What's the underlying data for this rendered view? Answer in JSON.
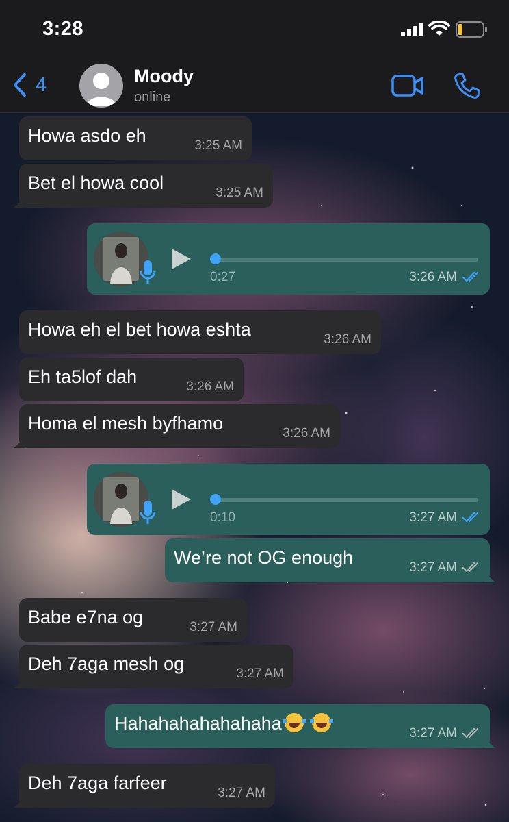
{
  "status_bar": {
    "time": "3:28"
  },
  "header": {
    "back_count": "4",
    "contact_name": "Moody",
    "contact_status": "online"
  },
  "colors": {
    "accent": "#3b8ff5",
    "incoming_bubble": "#2b2b2d",
    "outgoing_bubble": "#2a5f5c",
    "voice_progress": "#3fa4f8",
    "battery_low": "#f5c33b"
  },
  "messages": [
    {
      "dir": "in",
      "text": "Howa asdo eh",
      "time": "3:25 AM"
    },
    {
      "dir": "in",
      "text": "Bet el howa cool",
      "time": "3:25 AM"
    },
    {
      "dir": "out",
      "type": "voice",
      "duration": "0:27",
      "time": "3:26 AM",
      "progress": 0
    },
    {
      "dir": "in",
      "text": "Howa eh el bet howa eshta",
      "time": "3:26 AM"
    },
    {
      "dir": "in",
      "text": "Eh ta5lof dah",
      "time": "3:26 AM"
    },
    {
      "dir": "in",
      "text": "Homa el mesh byfhamo",
      "time": "3:26 AM"
    },
    {
      "dir": "out",
      "type": "voice",
      "duration": "0:10",
      "time": "3:27 AM",
      "progress": 0
    },
    {
      "dir": "out",
      "text": "We’re not OG enough",
      "time": "3:27 AM"
    },
    {
      "dir": "in",
      "text": "Babe e7na og",
      "time": "3:27 AM"
    },
    {
      "dir": "in",
      "text": "Deh 7aga mesh og",
      "time": "3:27 AM"
    },
    {
      "dir": "out",
      "text": "Hahahahahahahaha",
      "emoji": "tears-of-joy-emoji",
      "time": "3:27 AM"
    },
    {
      "dir": "in",
      "text": "Deh 7aga farfeer",
      "time": "3:27 AM"
    }
  ]
}
